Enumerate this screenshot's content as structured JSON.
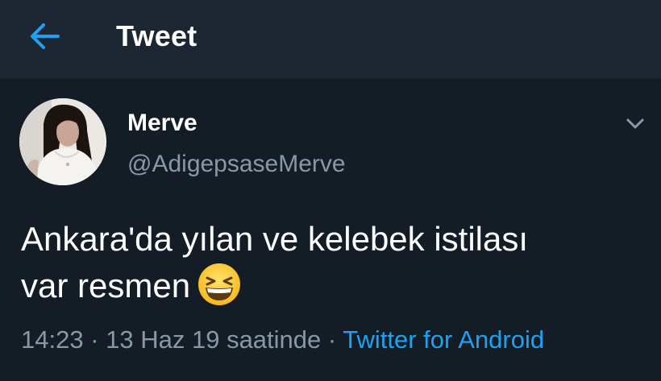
{
  "header": {
    "title": "Tweet",
    "accent_color": "#1da1f2",
    "back_icon": "arrow-left-icon"
  },
  "tweet": {
    "author_name": "Merve",
    "author_handle": "@AdigepsaseMerve",
    "text_line1": "Ankara'da yılan ve kelebek istilası",
    "text_line2": "var resmen",
    "emoji": "grinning-squinting-face-emoji",
    "time": "14:23",
    "separator1": " · ",
    "date": "13 Haz 19 saatinde",
    "separator2": " · ",
    "source": "Twitter for Android",
    "menu_icon": "chevron-down-icon"
  },
  "colors": {
    "background": "#141d26",
    "header_background": "#1c2733",
    "secondary_text": "#8899a6",
    "link": "#1da1f2"
  }
}
